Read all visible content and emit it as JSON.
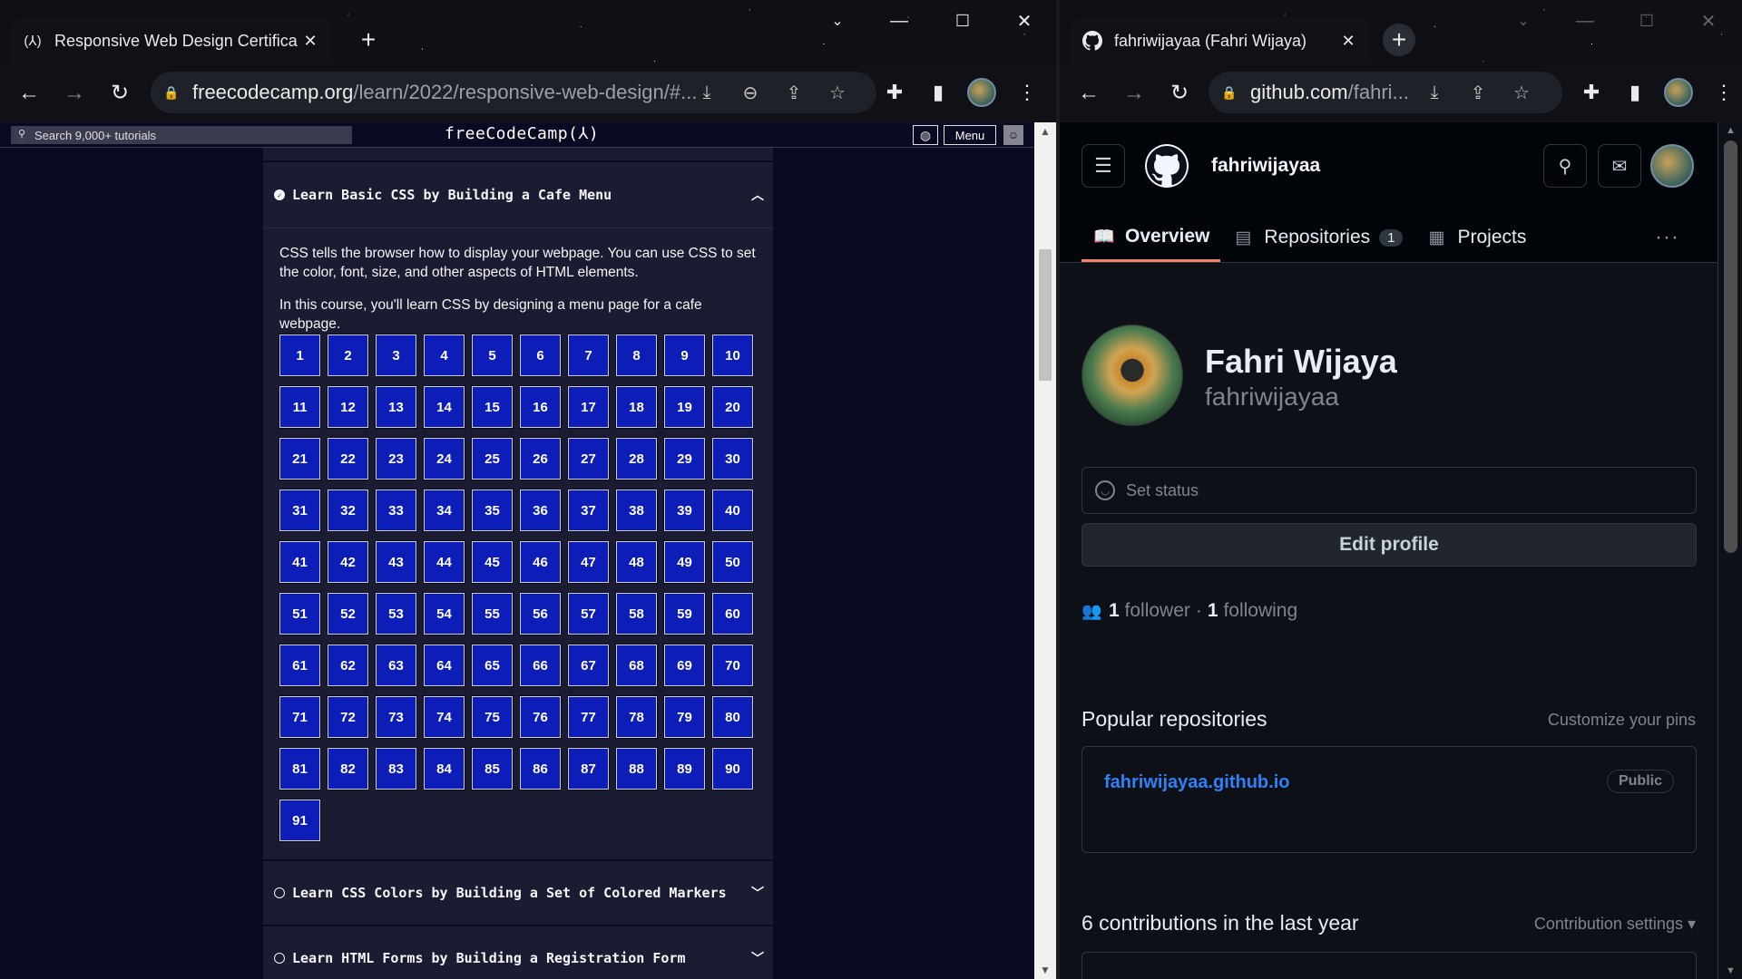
{
  "left_window": {
    "tab": {
      "favicon": "(⅄)",
      "title": "Responsive Web Design Certifica"
    },
    "url": {
      "host": "freecodecamp.org",
      "path": "/learn/2022/responsive-web-design/#..."
    }
  },
  "right_window": {
    "tab": {
      "title": "fahriwijayaa (Fahri Wijaya)"
    },
    "url": {
      "host": "github.com",
      "path": "/fahri..."
    }
  },
  "fcc": {
    "search_placeholder": "Search 9,000+ tutorials",
    "logo": "freeCodeCamp(⅄)",
    "menu_label": "Menu",
    "current_block": {
      "title": "Learn Basic CSS by Building a Cafe Menu",
      "intro": [
        "CSS tells the browser how to display your webpage. You can use CSS to set the color, font, size, and other aspects of HTML elements.",
        "In this course, you'll learn CSS by designing a menu page for a cafe webpage."
      ],
      "step_count": 91
    },
    "other_blocks": [
      "Learn CSS Colors by Building a Set of Colored Markers",
      "Learn HTML Forms by Building a Registration Form"
    ]
  },
  "github": {
    "username": "fahriwijayaa",
    "tabs": [
      {
        "label": "Overview",
        "icon": "book-icon"
      },
      {
        "label": "Repositories",
        "icon": "repo-icon",
        "count": "1"
      },
      {
        "label": "Projects",
        "icon": "table-icon"
      }
    ],
    "profile": {
      "name": "Fahri Wijaya",
      "login": "fahriwijayaa"
    },
    "set_status": "Set status",
    "edit_profile": "Edit profile",
    "followers": {
      "count": "1",
      "label": "follower",
      "sep": "·",
      "following_count": "1",
      "following_label": "following"
    },
    "popular": {
      "title": "Popular repositories",
      "customize": "Customize your pins"
    },
    "repo": {
      "name": "fahriwijayaa.github.io",
      "visibility": "Public"
    },
    "contributions": {
      "title": "6 contributions in the last year",
      "settings": "Contribution settings ▾"
    }
  },
  "colors": {
    "fcc_bg": "#0a0a23",
    "fcc_step": "#0d1db8",
    "gh_bg": "#0d1117",
    "gh_link": "#2f81f7",
    "gh_tab_underline": "#f78166"
  }
}
